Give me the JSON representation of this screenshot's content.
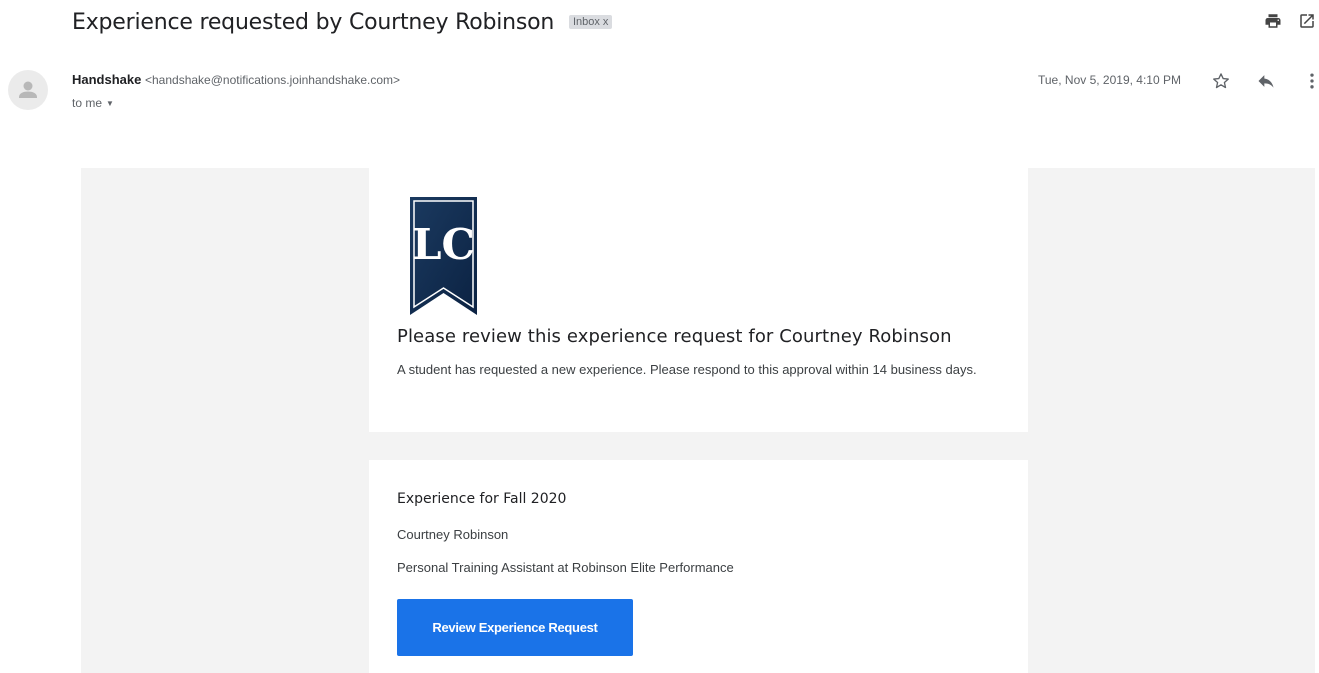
{
  "email": {
    "subject": "Experience requested by Courtney Robinson",
    "label_chip": "Inbox",
    "label_remove": "x",
    "sender_name": "Handshake",
    "sender_email": "<handshake@notifications.joinhandshake.com>",
    "recipient": "to me",
    "date": "Tue, Nov 5, 2019, 4:10 PM"
  },
  "icons": {
    "print": "printer-icon",
    "new_window": "open-in-new-window-icon",
    "star": "star-icon",
    "reply": "reply-icon",
    "more": "more-vertical-icon",
    "avatar": "avatar-icon",
    "dropdown": "caret-down-icon"
  },
  "message": {
    "card1": {
      "logo_text": "LC",
      "title": "Please review this experience request for Courtney Robinson",
      "body": "A student has requested a new experience. Please respond to this approval within 14 business days."
    },
    "card2": {
      "title": "Experience for Fall 2020",
      "student": "Courtney Robinson",
      "position": "Personal Training Assistant at Robinson Elite Performance",
      "button_label": "Review Experience Request"
    }
  },
  "colors": {
    "primary_button": "#1a73e8",
    "logo_navy": "#0f2b4e",
    "email_background": "#f3f3f3"
  }
}
